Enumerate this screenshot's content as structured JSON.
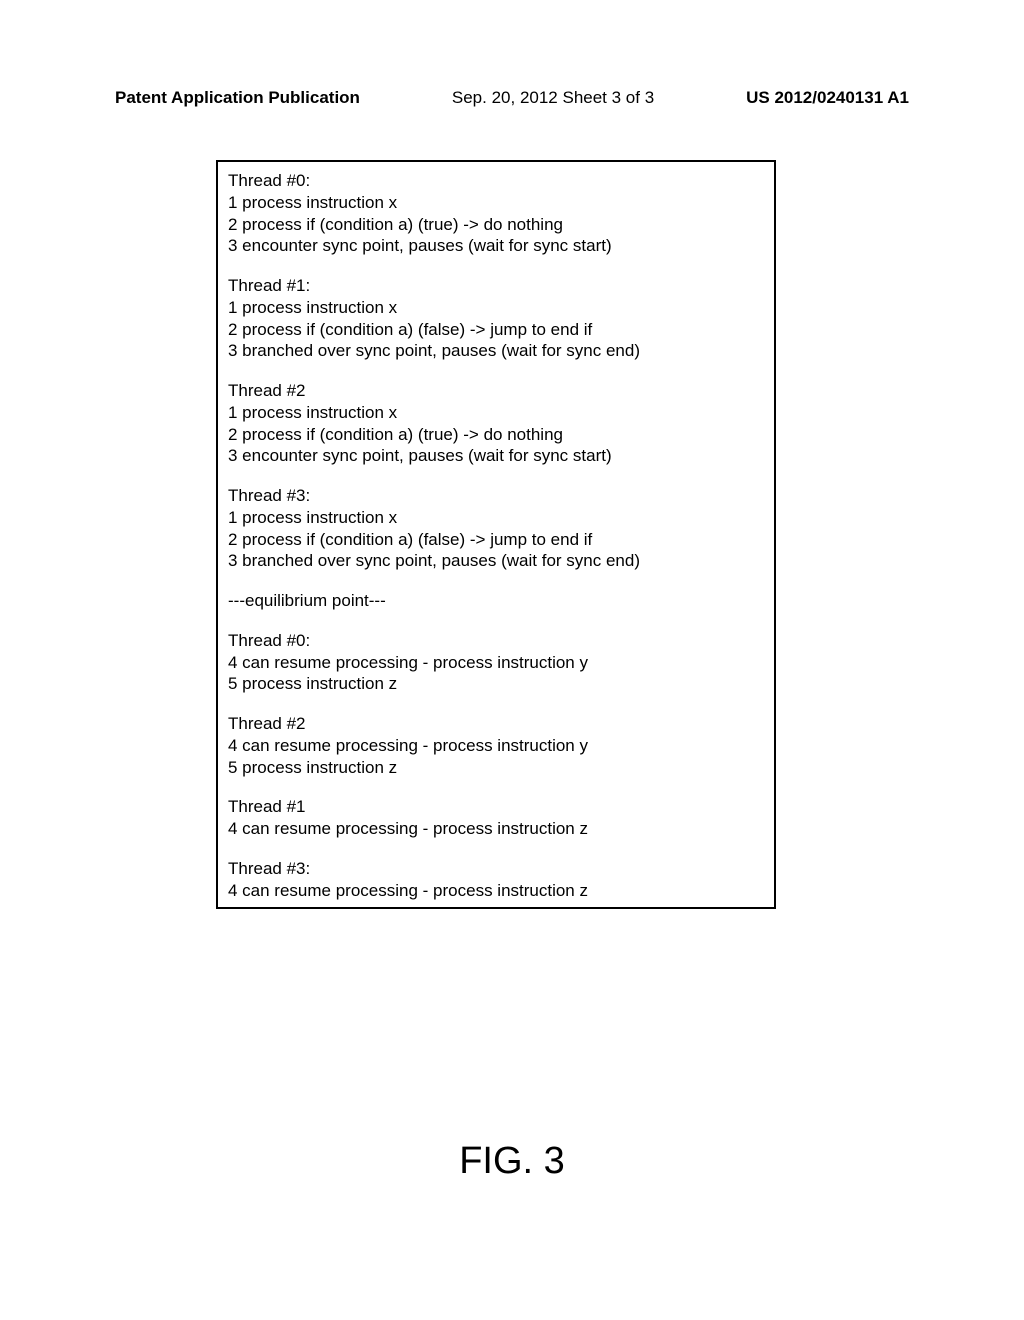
{
  "header": {
    "left": "Patent Application Publication",
    "center": "Sep. 20, 2012  Sheet 3 of 3",
    "right": "US 2012/0240131 A1"
  },
  "figure": {
    "label": "FIG. 3",
    "blocks": [
      {
        "lines": [
          "Thread #0:",
          "1 process instruction x",
          "2 process if (condition a) (true) -> do nothing",
          "3 encounter sync point, pauses (wait for sync start)"
        ]
      },
      {
        "lines": [
          "Thread #1:",
          "1 process instruction x",
          "2 process if (condition a) (false) -> jump to end if",
          "3 branched over sync point, pauses (wait for sync end)"
        ]
      },
      {
        "lines": [
          "Thread #2",
          "1 process instruction x",
          "2 process if (condition a) (true) -> do nothing",
          "3 encounter sync point, pauses (wait for sync start)"
        ]
      },
      {
        "lines": [
          "Thread #3:",
          "1 process instruction x",
          "2 process if (condition a) (false) -> jump to end if",
          "3 branched over sync point, pauses (wait for sync end)"
        ]
      },
      {
        "lines": [
          "---equilibrium point---"
        ]
      },
      {
        "lines": [
          "Thread #0:",
          "4 can resume processing - process instruction y",
          "5 process instruction z"
        ]
      },
      {
        "lines": [
          "Thread #2",
          "4 can resume processing - process instruction y",
          "5 process instruction z"
        ]
      },
      {
        "lines": [
          "Thread #1",
          "4 can resume processing - process instruction z"
        ]
      },
      {
        "lines": [
          "Thread #3:",
          "4 can resume processing - process instruction z"
        ]
      }
    ]
  }
}
